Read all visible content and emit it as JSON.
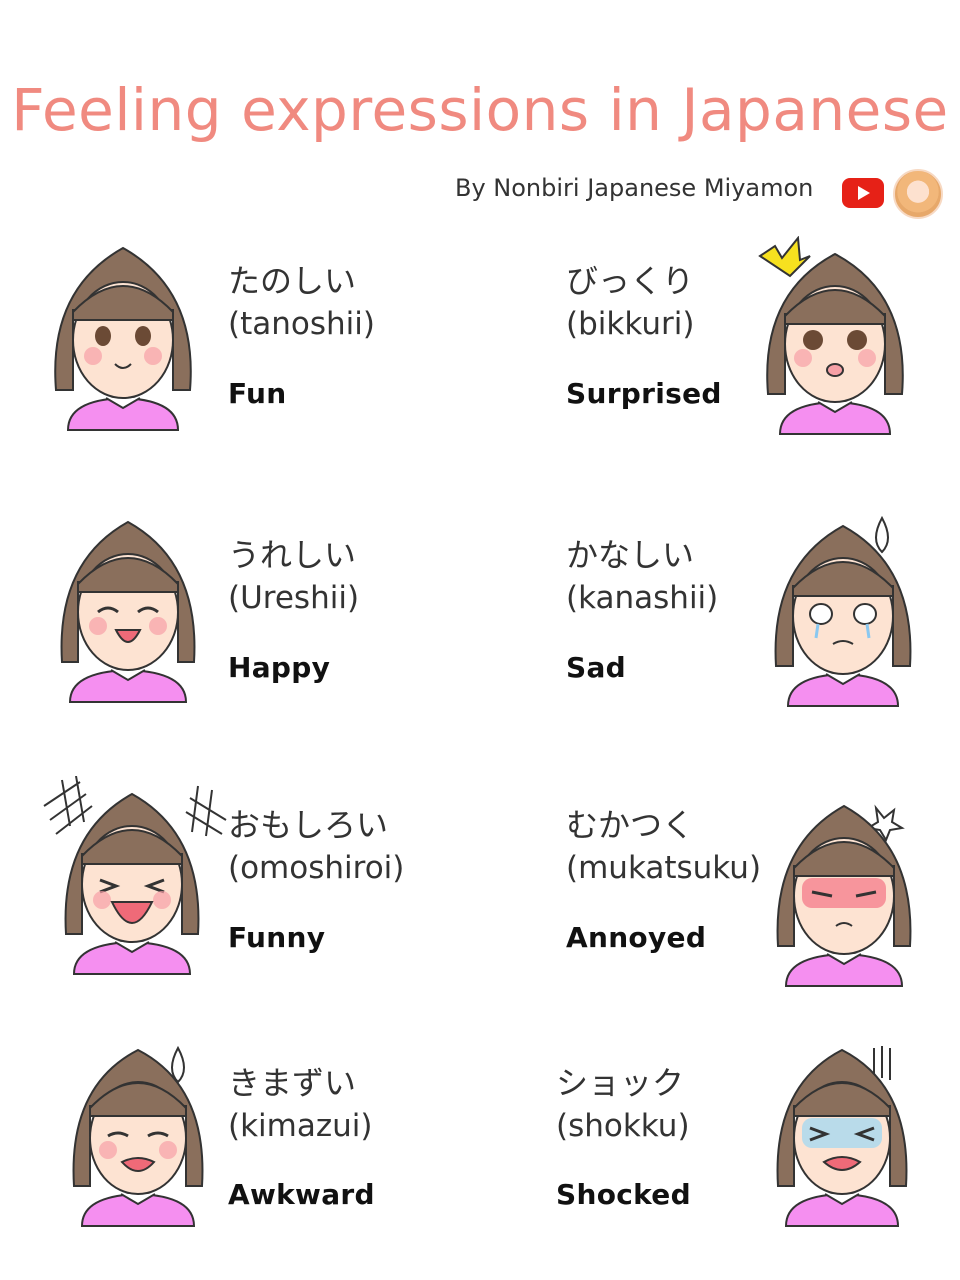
{
  "title": "Feeling expressions in Japanese",
  "byline": "By Nonbiri Japanese Miyamon",
  "icons": {
    "youtube": "youtube-play-icon",
    "avatar": "author-avatar"
  },
  "colors": {
    "title": "#f08a80",
    "hair": "#8a6f5c",
    "shirt": "#f58ff0",
    "youtube": "#e62117"
  },
  "expressions": [
    {
      "japanese": "たのしい",
      "romaji": "(tanoshii)",
      "english": "Fun"
    },
    {
      "japanese": "びっくり",
      "romaji": "(bikkuri)",
      "english": "Surprised"
    },
    {
      "japanese": "うれしい",
      "romaji": "(Ureshii)",
      "english": "Happy"
    },
    {
      "japanese": "かなしい",
      "romaji": "(kanashii)",
      "english": "Sad"
    },
    {
      "japanese": "おもしろい",
      "romaji": "(omoshiroi)",
      "english": "Funny"
    },
    {
      "japanese": "むかつく",
      "romaji": "(mukatsuku)",
      "english": "Annoyed"
    },
    {
      "japanese": "きまずい",
      "romaji": "(kimazui)",
      "english": "Awkward"
    },
    {
      "japanese": "ショック",
      "romaji": "(shokku)",
      "english": "Shocked"
    }
  ]
}
